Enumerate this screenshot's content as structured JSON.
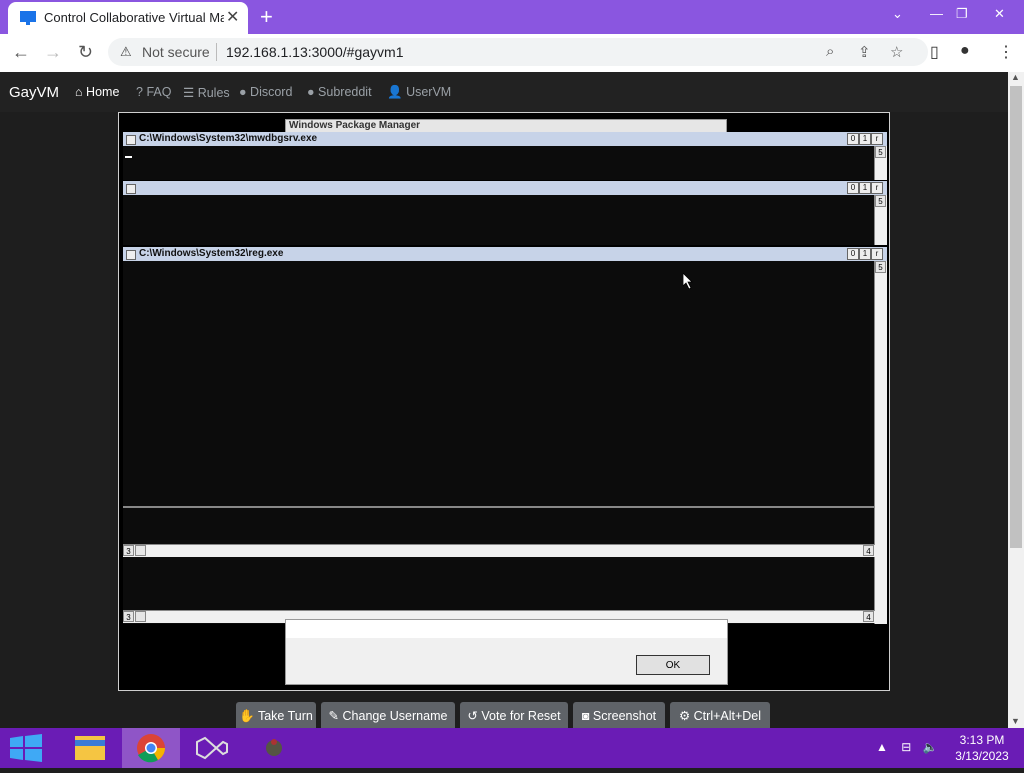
{
  "browser": {
    "tab_title": "Control Collaborative Virtual Mac",
    "tab_close": "✕",
    "new_tab": "+",
    "url_warning": "Not secure",
    "url": "192.168.1.13:3000/#gayvm1"
  },
  "site": {
    "brand": "GayVM",
    "nav": [
      {
        "label": "Home",
        "icon": "home-icon"
      },
      {
        "label": "FAQ",
        "icon": "question-icon"
      },
      {
        "label": "Rules",
        "icon": "rules-icon"
      },
      {
        "label": "Discord",
        "icon": "discord-icon"
      },
      {
        "label": "Subreddit",
        "icon": "reddit-icon"
      },
      {
        "label": "UserVM",
        "icon": "user-icon"
      }
    ]
  },
  "vm": {
    "package_manager_title": "Windows Package Manager",
    "windows": [
      {
        "title": "C:\\Windows\\System32\\mwdbgsrv.exe"
      },
      {
        "title": ""
      },
      {
        "title": "C:\\Windows\\System32\\reg.exe"
      }
    ],
    "ok_label": "OK"
  },
  "controls": {
    "take_turn": "Take Turn",
    "change_username": "Change Username",
    "vote_reset": "Vote for Reset",
    "screenshot": "Screenshot",
    "ctrl_alt_del": "Ctrl+Alt+Del"
  },
  "taskbar": {
    "time": "3:13 PM",
    "date": "3/13/2023"
  }
}
